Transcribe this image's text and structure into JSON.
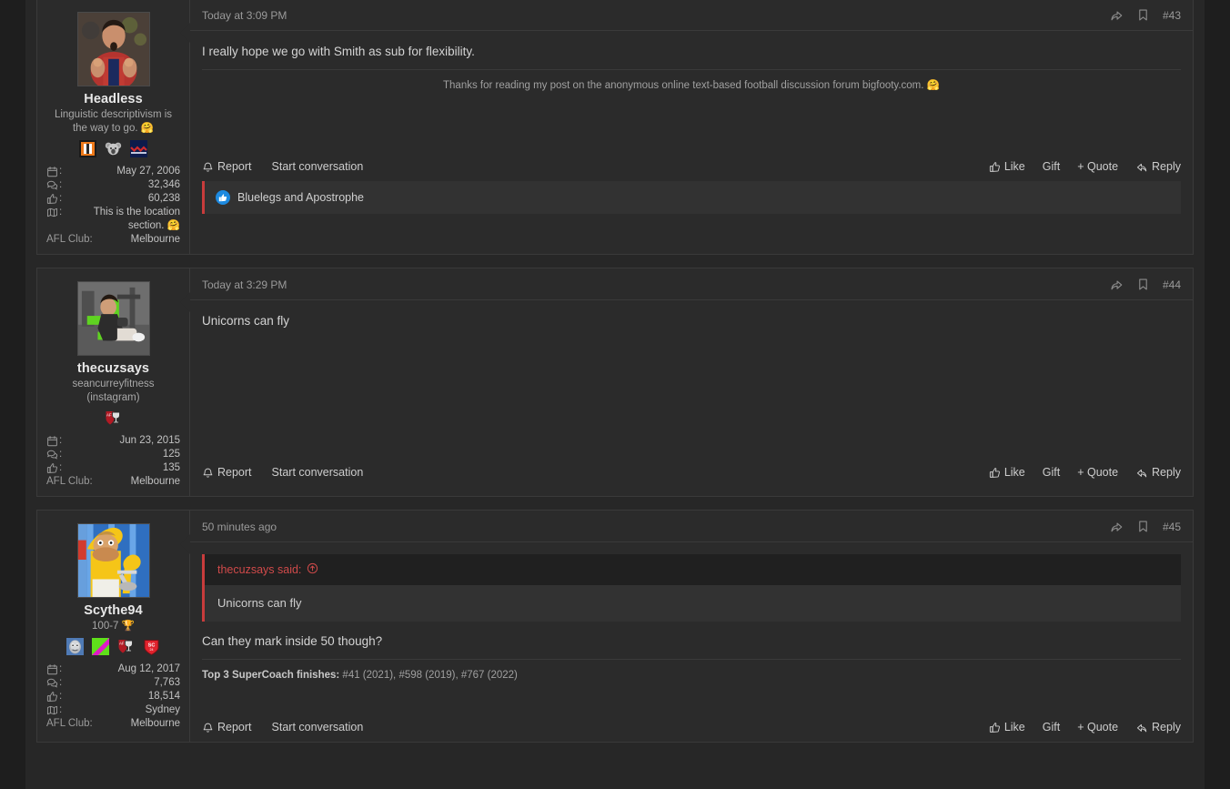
{
  "theme": {
    "page_bg": "#1e1e1e",
    "column_bg": "#272727",
    "card_bg": "#2b2b2b",
    "border": "#3a3a3a",
    "accent_red": "#c83c3c",
    "link_red": "#d04a4a",
    "reaction_blue": "#1d8ae0",
    "text_primary": "#d4d4d4",
    "text_muted": "#9a9a9a"
  },
  "labels": {
    "report": "Report",
    "start_conversation": "Start conversation",
    "like": "Like",
    "gift": "Gift",
    "quote": "+ Quote",
    "reply": "Reply",
    "afl_club_label": "AFL Club:",
    "colon": ":"
  },
  "posts": [
    {
      "id": "post-43",
      "post_number": "#43",
      "timestamp": "Today at 3:09 PM",
      "user": {
        "name": "Headless",
        "title": "Linguistic descriptivism is the way to go. 🤗",
        "avatar_name": "avatar-headless-afl-player",
        "badges": [
          "badge-orange-pillars-icon",
          "badge-koala-icon",
          "badge-melbourne-demons-icon"
        ],
        "stats": [
          {
            "icon": "calendar-icon",
            "label": "",
            "value": "May 27, 2006"
          },
          {
            "icon": "messages-icon",
            "label": "",
            "value": "32,346"
          },
          {
            "icon": "thumbsup-icon",
            "label": "",
            "value": "60,238"
          },
          {
            "icon": "map-icon",
            "label": "",
            "value": "This is the location section. 🤗"
          }
        ],
        "club_label": "AFL Club:",
        "club_value": "Melbourne"
      },
      "body": "I really hope we go with Smith as sub for flexibility.",
      "signature": "Thanks for reading my post on the anonymous online text-based football discussion forum bigfooty.com. 🤗",
      "signature_centered": true,
      "quote": null,
      "likes": "Bluelegs and Apostrophe"
    },
    {
      "id": "post-44",
      "post_number": "#44",
      "timestamp": "Today at 3:29 PM",
      "user": {
        "name": "thecuzsays",
        "title": "seancurreyfitness (instagram)",
        "avatar_name": "avatar-thecuzsays-gym",
        "badges": [
          "badge-afl-trophy-icon"
        ],
        "stats": [
          {
            "icon": "calendar-icon",
            "label": "",
            "value": "Jun 23, 2015"
          },
          {
            "icon": "messages-icon",
            "label": "",
            "value": "125"
          },
          {
            "icon": "thumbsup-icon",
            "label": "",
            "value": "135"
          }
        ],
        "club_label": "AFL Club:",
        "club_value": "Melbourne"
      },
      "body": "Unicorns can fly",
      "signature": null,
      "signature_centered": false,
      "quote": null,
      "likes": null
    },
    {
      "id": "post-45",
      "post_number": "#45",
      "timestamp": "50 minutes ago",
      "user": {
        "name": "Scythe94",
        "title": "100-7 🏆",
        "avatar_name": "avatar-scythe94-homer",
        "badges": [
          "badge-stone-face-icon",
          "badge-green-magenta-icon",
          "badge-afl-trophy-icon",
          "badge-supercoach-icon"
        ],
        "stats": [
          {
            "icon": "calendar-icon",
            "label": "",
            "value": "Aug 12, 2017"
          },
          {
            "icon": "messages-icon",
            "label": "",
            "value": "7,763"
          },
          {
            "icon": "thumbsup-icon",
            "label": "",
            "value": "18,514"
          },
          {
            "icon": "map-icon",
            "label": "",
            "value": "Sydney"
          }
        ],
        "club_label": "AFL Club:",
        "club_value": "Melbourne"
      },
      "body": "Can they mark inside 50 though?",
      "signature_bold": "Top 3 SuperCoach finishes:",
      "signature_rest": " #41 (2021), #598 (2019), #767 (2022)",
      "signature_centered": false,
      "quote": {
        "author_line": "thecuzsays said:",
        "text": "Unicorns can fly"
      },
      "likes": null
    }
  ]
}
